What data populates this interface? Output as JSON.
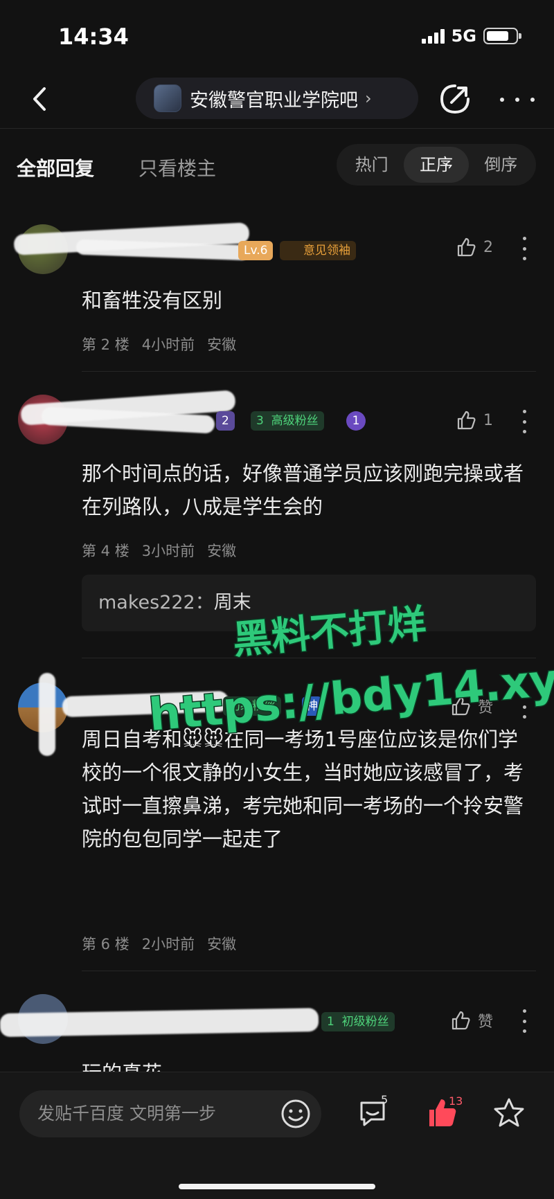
{
  "status_bar": {
    "time": "14:34",
    "network": "5G"
  },
  "nav": {
    "forum_name": "安徽警官职业学院吧",
    "chevron": "›"
  },
  "filters": {
    "all_replies": "全部回复",
    "only_op": "只看楼主",
    "sort": [
      "热门",
      "正序",
      "倒序"
    ],
    "active_sort": "正序"
  },
  "posts": [
    {
      "badges": {
        "level": "Lv.6",
        "title": "意见领袖"
      },
      "like_count": "2",
      "content": "和畜牲没有区别",
      "floor": "第 2 楼",
      "time": "4小时前",
      "location": "安徽"
    },
    {
      "badges": {
        "level": "2",
        "fan_level": "3",
        "title": "高级粉丝",
        "icon_num": "1"
      },
      "like_count": "1",
      "content": "那个时间点的话，好像普通学员应该刚跑完操或者在列路队，八成是学生会的",
      "floor": "第 4 楼",
      "time": "3小时前",
      "location": "安徽",
      "reply": {
        "user": "makes222",
        "sep": "：",
        "text": "周末"
      }
    },
    {
      "badges": {
        "title": "初级粉丝",
        "god": "神"
      },
      "like_label": "赞",
      "content": "周日自考和🐭🐭在同一考场1号座位应该是你们学校的一个很文静的小女生，当时她应该感冒了，考试时一直擦鼻涕，考完她和同一考场的一个拎安警院的包包同学一起走了",
      "floor": "第 6 楼",
      "time": "2小时前",
      "location": "安徽"
    },
    {
      "badges": {
        "fan_level": "1",
        "title": "初级粉丝"
      },
      "like_label": "赞",
      "content": "玩的真花"
    }
  ],
  "watermark": {
    "line1": "黑料不打烊",
    "line2": "https://bdy14.xyz"
  },
  "bottom_bar": {
    "input_placeholder": "发贴千百度 文明第一步",
    "comment_count": "5",
    "like_count": "13"
  }
}
